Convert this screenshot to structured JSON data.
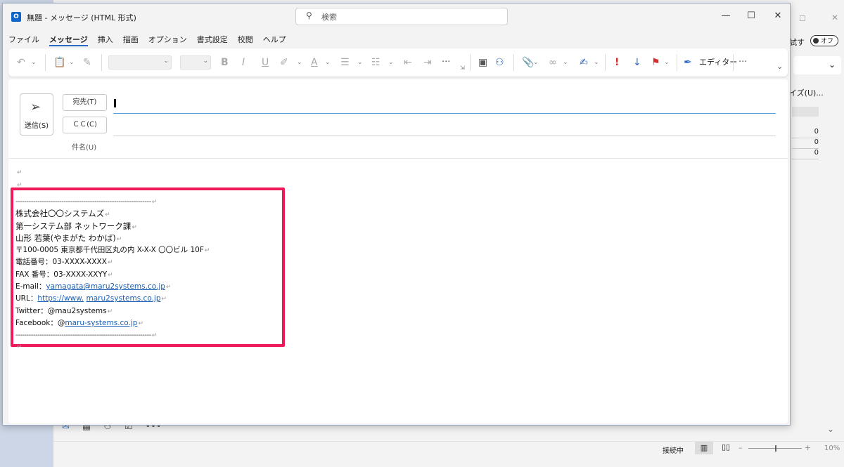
{
  "window": {
    "title": "無題 - メッセージ (HTML 形式)",
    "search_placeholder": "検索"
  },
  "menu": {
    "items": [
      {
        "label": "ファイル"
      },
      {
        "label": "メッセージ"
      },
      {
        "label": "挿入"
      },
      {
        "label": "描画"
      },
      {
        "label": "オプション"
      },
      {
        "label": "書式設定"
      },
      {
        "label": "校閲"
      },
      {
        "label": "ヘルプ"
      }
    ],
    "active": "メッセージ"
  },
  "ribbon": {
    "editor_label": "エディター"
  },
  "compose": {
    "send_label": "送信(S)",
    "to_label": "宛先(T)",
    "cc_label": "ＣＣ(C)",
    "subject_label": "件名(U)"
  },
  "signature": {
    "separator": "--------------------------------------------------------------",
    "company": "株式会社〇〇システムズ",
    "department": "第一システム部 ネットワーク課",
    "name": "山形 若葉(やまがた わかば)",
    "address": "〒100-0005 東京都千代田区丸の内 X-X-X 〇〇ビル 10F",
    "phone": "電話番号：03-XXXX-XXXX",
    "fax": "FAX 番号：03-XXXX-XXYY",
    "email_label": "E-mail：",
    "email": "yamagata@maru2systems.co.jp",
    "url_label": "URL：",
    "url_part1": "https://www.",
    "url_part2": "maru2systems.co.jp",
    "twitter": "Twitter：@mau2systems",
    "facebook_label": "Facebook：@",
    "facebook": "maru-systems.co.jp"
  },
  "background": {
    "try_label": "試す",
    "toggle_label": "オフ",
    "size_label": "イズ(U)...",
    "counts": [
      "0",
      "0",
      "0"
    ],
    "status_text": "接続中",
    "zoom": "10%"
  },
  "colors": {
    "highlight_border": "#f0195a",
    "accent": "#2b6bc6"
  }
}
